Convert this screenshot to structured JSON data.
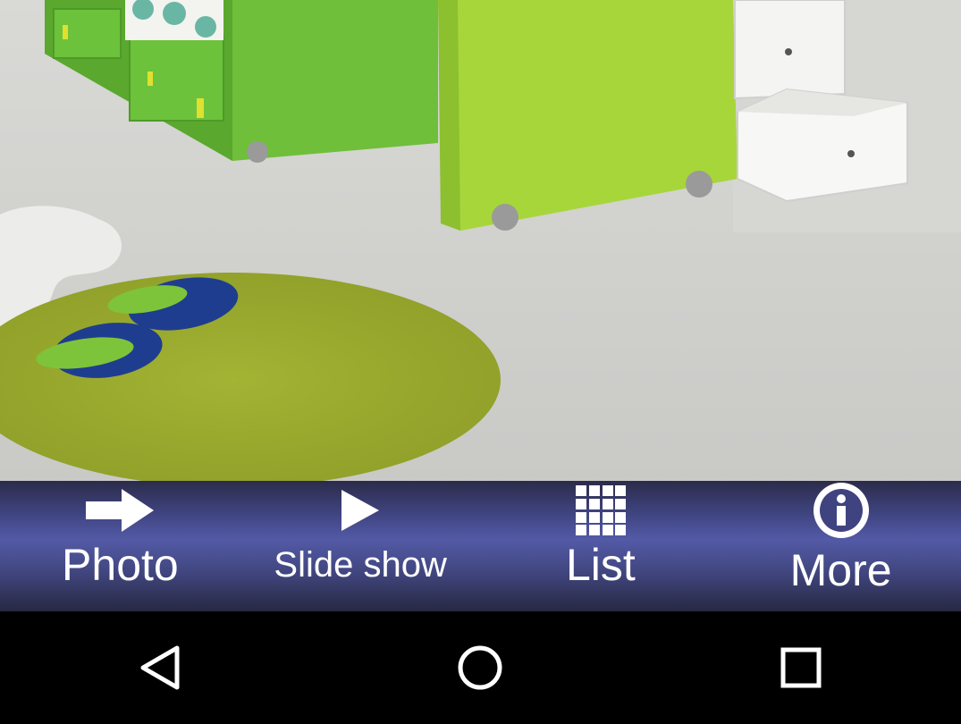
{
  "toolbar": {
    "items": [
      {
        "label": "Photo",
        "icon": "arrow-right-icon"
      },
      {
        "label": "Slide show",
        "icon": "play-icon"
      },
      {
        "label": "List",
        "icon": "grid-icon"
      },
      {
        "label": "More",
        "icon": "info-icon"
      }
    ]
  },
  "navbar": {
    "items": [
      {
        "icon": "back-icon"
      },
      {
        "icon": "home-icon"
      },
      {
        "icon": "recents-icon"
      }
    ]
  },
  "colors": {
    "toolbar_mid": "#535aa6",
    "toolbar_dark": "#272841",
    "navbar": "#000000",
    "furniture_green": "#8dc63f",
    "rug_green": "#9bab2e",
    "slipper_blue": "#1f3d8f"
  }
}
